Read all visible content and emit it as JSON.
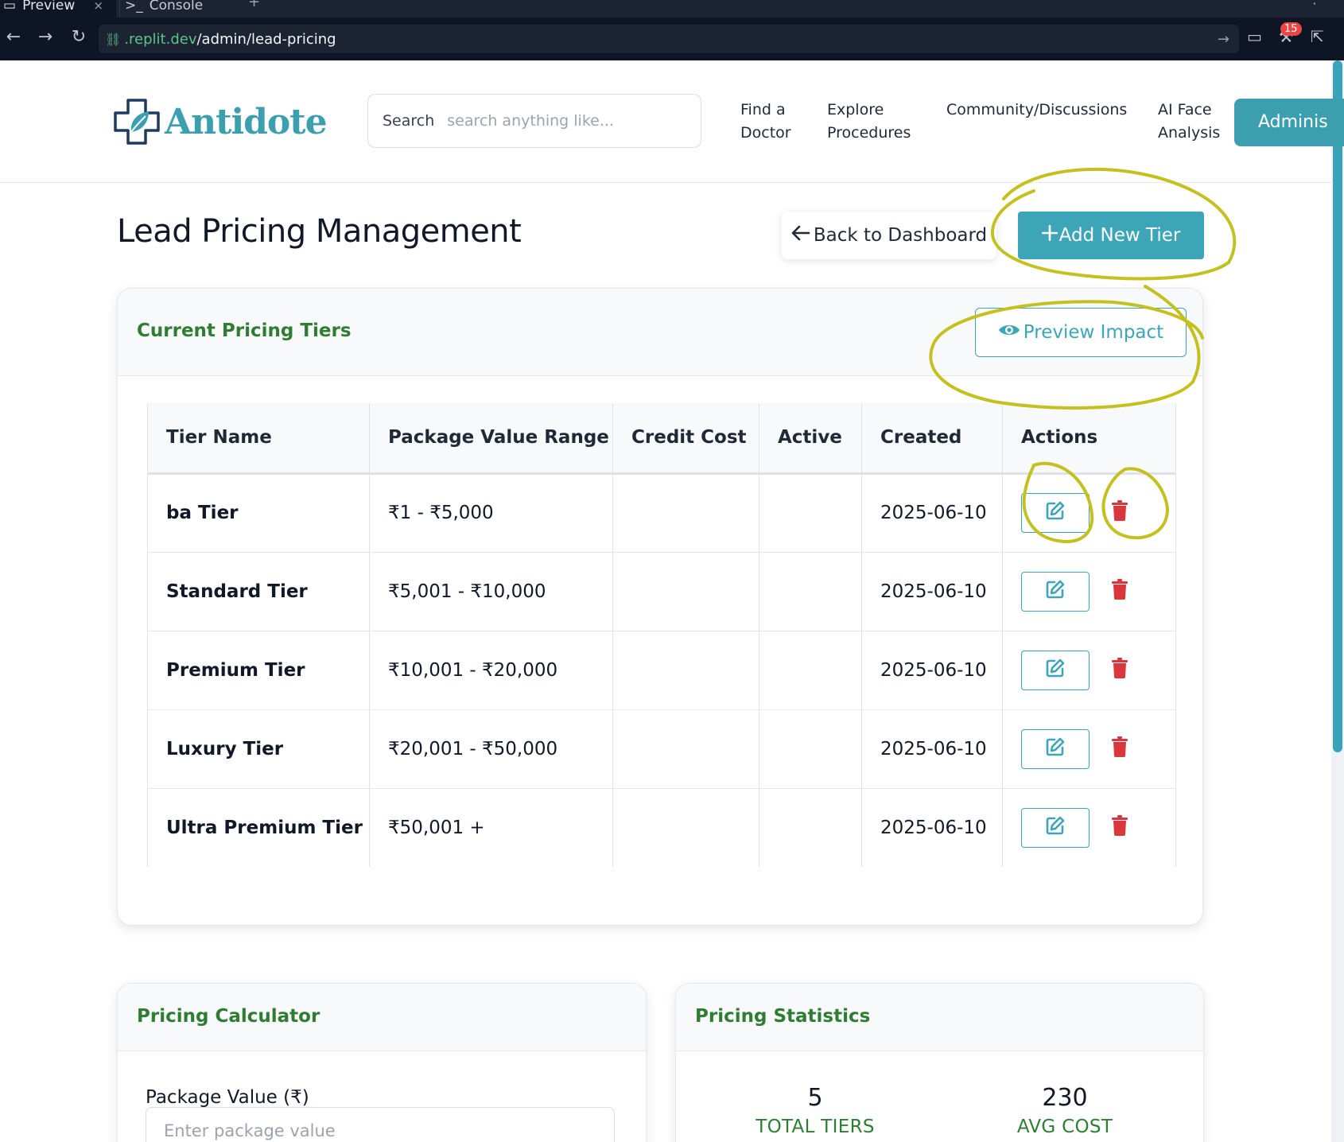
{
  "browser": {
    "tabs": [
      {
        "label": "Preview"
      },
      {
        "label": "Console"
      }
    ],
    "url_domain": ".replit.dev",
    "url_path": "/admin/lead-pricing",
    "notification_count": "15"
  },
  "header": {
    "logo_text": "Antidote",
    "search_label": "Search",
    "search_placeholder": "search anything like...",
    "nav": [
      {
        "line1": "Find a",
        "line2": "Doctor"
      },
      {
        "line1": "Explore",
        "line2": "Procedures"
      },
      {
        "line1": "Community/Discussions",
        "line2": ""
      },
      {
        "line1": "AI Face",
        "line2": "Analysis"
      }
    ],
    "admin_label": "Adminis"
  },
  "page": {
    "title": "Lead Pricing Management",
    "back_label": "Back to Dashboard",
    "add_label": "Add New Tier"
  },
  "tiers_card": {
    "title": "Current Pricing Tiers",
    "preview_label": "Preview Impact",
    "columns": [
      "Tier Name",
      "Package Value Range",
      "Credit Cost",
      "Active",
      "Created",
      "Actions"
    ],
    "rows": [
      {
        "name": "ba Tier",
        "range": "₹1 - ₹5,000",
        "credit": "",
        "active": "",
        "created": "2025-06-10"
      },
      {
        "name": "Standard Tier",
        "range": "₹5,001 - ₹10,000",
        "credit": "",
        "active": "",
        "created": "2025-06-10"
      },
      {
        "name": "Premium Tier",
        "range": "₹10,001 - ₹20,000",
        "credit": "",
        "active": "",
        "created": "2025-06-10"
      },
      {
        "name": "Luxury Tier",
        "range": "₹20,001 - ₹50,000",
        "credit": "",
        "active": "",
        "created": "2025-06-10"
      },
      {
        "name": "Ultra Premium Tier",
        "range": "₹50,001 +",
        "credit": "",
        "active": "",
        "created": "2025-06-10"
      }
    ]
  },
  "calculator_card": {
    "title": "Pricing Calculator",
    "input_label": "Package Value (₹)",
    "input_placeholder": "Enter package value"
  },
  "stats_card": {
    "title": "Pricing Statistics",
    "stats": [
      {
        "value": "5",
        "label": "TOTAL TIERS"
      },
      {
        "value": "230",
        "label": "AVG COST"
      }
    ]
  },
  "colors": {
    "brand_teal": "#3ca5b8",
    "heading_green": "#2e7d32",
    "delete_red": "#d9363e",
    "annotation_yellow": "#c4c01f",
    "chrome_dark": "#0e1525"
  }
}
